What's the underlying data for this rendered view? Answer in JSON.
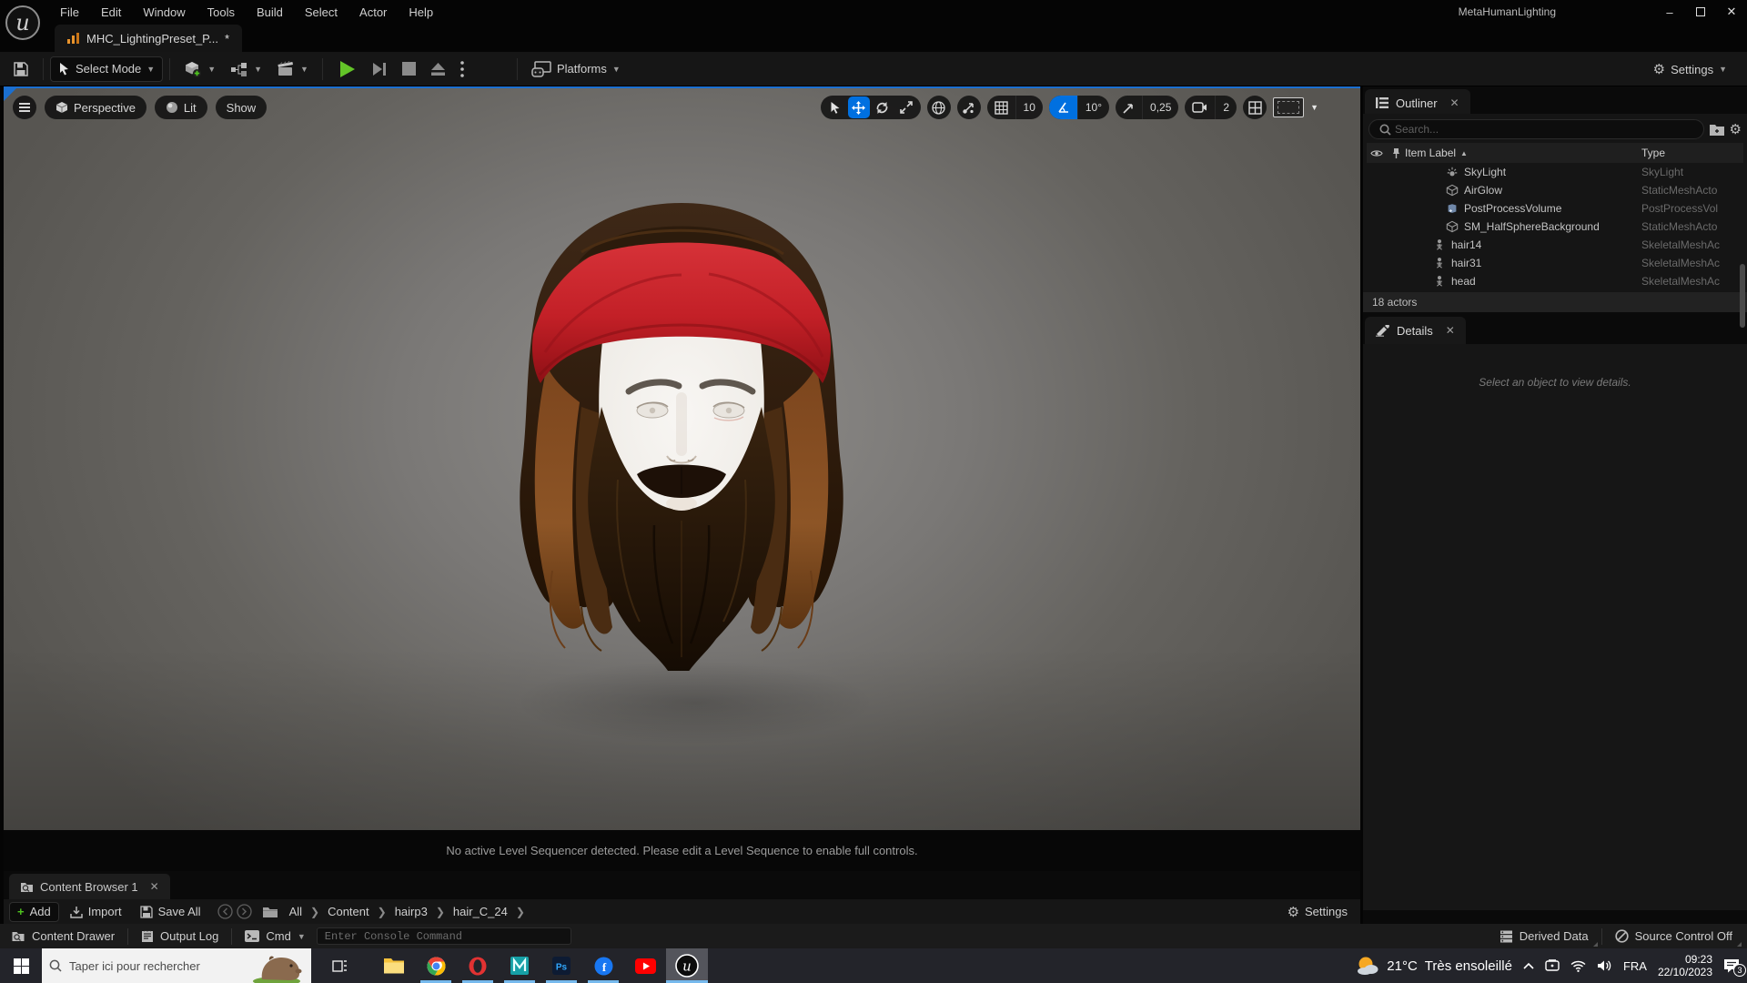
{
  "window": {
    "title": "MetaHumanLighting",
    "menus": [
      "File",
      "Edit",
      "Window",
      "Tools",
      "Build",
      "Select",
      "Actor",
      "Help"
    ],
    "tab_label": "MHC_LightingPreset_P...",
    "dirty_mark": "*"
  },
  "toolbar": {
    "select_mode": "Select Mode",
    "platforms": "Platforms",
    "settings": "Settings"
  },
  "viewport": {
    "perspective": "Perspective",
    "lit": "Lit",
    "show": "Show",
    "grid_snap_value": "10",
    "rotation_snap_value": "10°",
    "scale_snap_value": "0,25",
    "camera_speed_value": "2",
    "sequencer_message": "No active Level Sequencer detected. Please edit a Level Sequence to enable full controls."
  },
  "outliner": {
    "title": "Outliner",
    "search_placeholder": "Search...",
    "col_item_label": "Item Label",
    "col_type": "Type",
    "rows": [
      {
        "label": "SkyLight",
        "type": "SkyLight",
        "icon": "skylight",
        "indent": 2
      },
      {
        "label": "AirGlow",
        "type": "StaticMeshActo",
        "icon": "staticmesh",
        "indent": 2
      },
      {
        "label": "PostProcessVolume",
        "type": "PostProcessVol",
        "icon": "postprocess",
        "indent": 2
      },
      {
        "label": "SM_HalfSphereBackground",
        "type": "StaticMeshActo",
        "icon": "staticmesh",
        "indent": 2
      },
      {
        "label": "hair14",
        "type": "SkeletalMeshAc",
        "icon": "skeletalmesh",
        "indent": 1
      },
      {
        "label": "hair31",
        "type": "SkeletalMeshAc",
        "icon": "skeletalmesh",
        "indent": 1
      },
      {
        "label": "head",
        "type": "SkeletalMeshAc",
        "icon": "skeletalmesh",
        "indent": 1
      }
    ],
    "footer": "18 actors"
  },
  "details": {
    "title": "Details",
    "empty_message": "Select an object to view details."
  },
  "content_browser": {
    "tab": "Content Browser 1",
    "add": "Add",
    "import": "Import",
    "save_all": "Save All",
    "crumbs": [
      "All",
      "Content",
      "hairp3",
      "hair_C_24"
    ],
    "settings": "Settings"
  },
  "status_bar": {
    "content_drawer": "Content Drawer",
    "output_log": "Output Log",
    "cmd": "Cmd",
    "console_placeholder": "Enter Console Command",
    "derived_data": "Derived Data",
    "source_control": "Source Control Off"
  },
  "taskbar": {
    "search_placeholder": "Taper ici pour rechercher",
    "weather_temp": "21°C",
    "weather_desc": "Très ensoleillé",
    "language": "FRA",
    "time": "09:23",
    "date": "22/10/2023",
    "notification_count": "3"
  },
  "colors": {
    "accent_blue": "#0070e0",
    "play_green": "#63c428",
    "headband_red": "#c32027",
    "viewport_focus": "#1b6fd0"
  }
}
